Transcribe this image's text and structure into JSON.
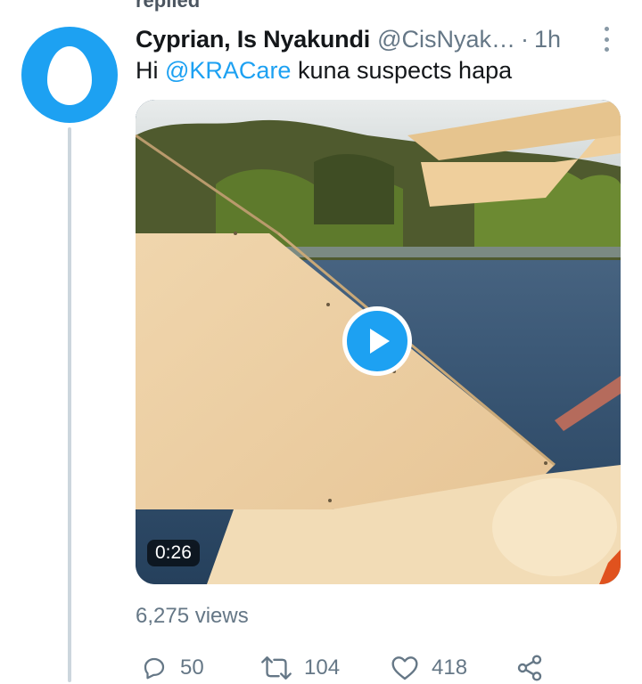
{
  "context": {
    "label": "replied"
  },
  "tweet": {
    "display_name": "Cyprian, Is Nyakundi",
    "handle": "@CisNyak…",
    "separator": "·",
    "time": "1h",
    "text_before": "Hi ",
    "mention": "@KRACare",
    "text_after": " kuna suspects hapa",
    "video_duration": "0:26",
    "views": "6,275 views"
  },
  "actions": {
    "replies": "50",
    "retweets": "104",
    "likes": "418"
  },
  "icons": {
    "avatar": "default-egg-avatar",
    "more": "more-vertical-icon",
    "play": "play-icon",
    "reply": "reply-icon",
    "retweet": "retweet-icon",
    "like": "heart-icon",
    "share": "share-icon"
  },
  "colors": {
    "accent": "#1da1f2",
    "text": "#14171a",
    "muted": "#657786",
    "thread_line": "#ccd6dd"
  }
}
